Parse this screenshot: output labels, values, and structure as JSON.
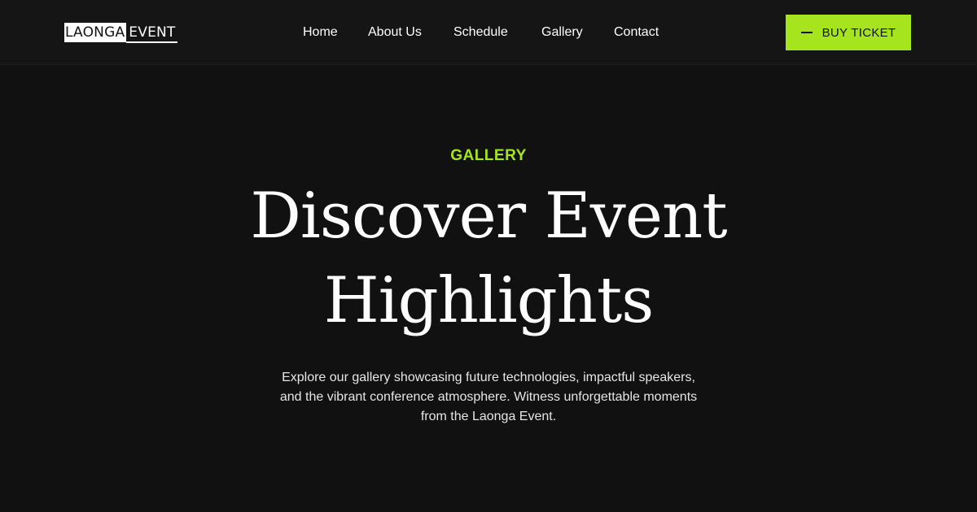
{
  "header": {
    "logo": {
      "part1": "LAONGA",
      "part2": "EVENT"
    },
    "nav": [
      "Home",
      "About Us",
      "Schedule",
      "Gallery",
      "Contact"
    ],
    "cta_label": "BUY TICKET"
  },
  "hero": {
    "eyebrow": "GALLERY",
    "title_lines": [
      "Discover Event",
      "Highlights"
    ],
    "description_lines": [
      "Explore our gallery showcasing future technologies, impactful speakers,",
      "and the vibrant conference atmosphere. Witness unforgettable moments",
      "from the Laonga Event."
    ]
  },
  "colors": {
    "background": "#111111",
    "header_background": "#151515",
    "accent": "#a6e51e",
    "text": "#ffffff"
  }
}
